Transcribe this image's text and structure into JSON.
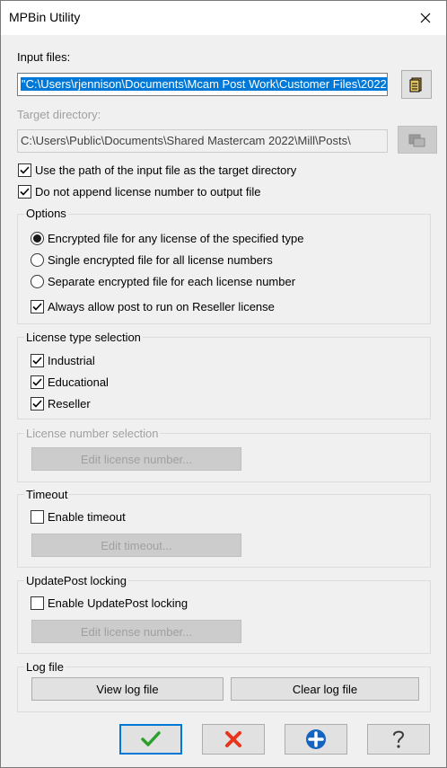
{
  "window": {
    "title": "MPBin Utility"
  },
  "input": {
    "label": "Input files:",
    "value": "\"C:\\Users\\rjennison\\Documents\\Mcam Post Work\\Customer Files\\2022\""
  },
  "target": {
    "label": "Target directory:",
    "value": "C:\\Users\\Public\\Documents\\Shared Mastercam 2022\\Mill\\Posts\\"
  },
  "checks": {
    "use_path": "Use the path of the input file as the target directory",
    "no_append": "Do not append license number to output file"
  },
  "options": {
    "title": "Options",
    "radio1": "Encrypted file for any license of the specified type",
    "radio2": "Single encrypted file for all license numbers",
    "radio3": "Separate encrypted file for each license number",
    "always": "Always allow post to run on Reseller license"
  },
  "license_type": {
    "title": "License type selection",
    "industrial": "Industrial",
    "educational": "Educational",
    "reseller": "Reseller"
  },
  "license_number": {
    "title": "License number selection",
    "edit": "Edit license number..."
  },
  "timeout": {
    "title": "Timeout",
    "enable": "Enable timeout",
    "edit": "Edit timeout..."
  },
  "updatepost": {
    "title": "UpdatePost locking",
    "enable": "Enable UpdatePost locking",
    "edit": "Edit license number..."
  },
  "log": {
    "title": "Log file",
    "view": "View log file",
    "clear": "Clear log file"
  },
  "colors": {
    "ok_check": "#2ca02c",
    "cancel_x": "#e8341c",
    "add_blue": "#1565c0",
    "selection": "#0078d7"
  }
}
